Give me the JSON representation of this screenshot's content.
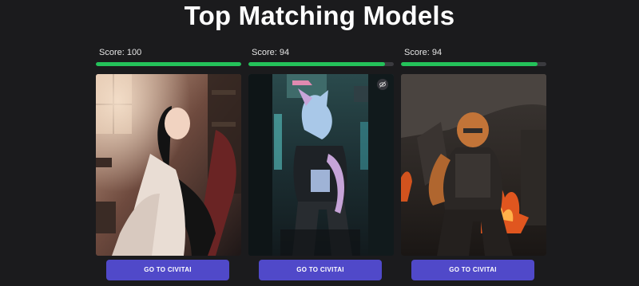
{
  "header": {
    "title": "Top Matching Models"
  },
  "models": [
    {
      "score_label": "Score: 100",
      "score_percent": 100,
      "button_label": "GO TO CIVITAI",
      "image_icon": "anime-girl-reclining-image",
      "has_hide_icon": false
    },
    {
      "score_label": "Score: 94",
      "score_percent": 94,
      "button_label": "GO TO CIVITAI",
      "image_icon": "cyberpunk-fox-character-image",
      "has_hide_icon": true
    },
    {
      "score_label": "Score: 94",
      "score_percent": 94,
      "button_label": "GO TO CIVITAI",
      "image_icon": "tiger-soldier-fire-image",
      "has_hide_icon": false
    }
  ],
  "colors": {
    "background": "#1b1b1d",
    "score_fill": "#24c25a",
    "score_track": "#3a3a3e",
    "button": "#5049c9"
  }
}
